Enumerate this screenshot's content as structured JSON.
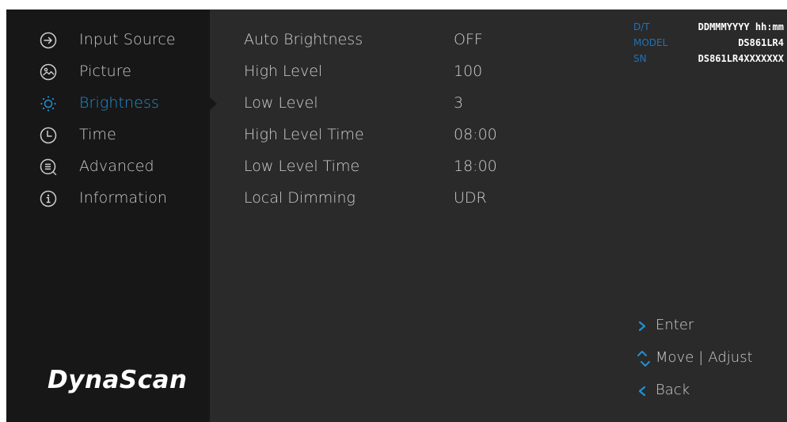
{
  "sidebar": {
    "items": [
      {
        "label": "Input Source",
        "icon": "input-source-icon"
      },
      {
        "label": "Picture",
        "icon": "picture-icon"
      },
      {
        "label": "Brightness",
        "icon": "brightness-icon"
      },
      {
        "label": "Time",
        "icon": "clock-icon"
      },
      {
        "label": "Advanced",
        "icon": "advanced-icon"
      },
      {
        "label": "Information",
        "icon": "info-icon"
      }
    ],
    "active_index": 2
  },
  "brand": {
    "logo_text": "DynaScan"
  },
  "settings": {
    "rows": [
      {
        "name": "Auto Brightness",
        "value": "OFF"
      },
      {
        "name": "High Level",
        "value": "100"
      },
      {
        "name": "Low Level",
        "value": "3"
      },
      {
        "name": "High Level Time",
        "value": "08:00"
      },
      {
        "name": "Low Level Time",
        "value": "18:00"
      },
      {
        "name": "Local Dimming",
        "value": "UDR"
      }
    ]
  },
  "device_info": {
    "dt_label": "D/T",
    "dt_value": "DDMMMYYYY hh:mm",
    "model_label": "MODEL",
    "model_value": "DS861LR4",
    "sn_label": "SN",
    "sn_value": "DS861LR4XXXXXXX"
  },
  "hints": {
    "enter": "Enter",
    "move": "Move",
    "divider": "|",
    "adjust": "Adjust",
    "back": "Back"
  },
  "colors": {
    "accent": "#1f91d6",
    "sidebar_bg": "#171717",
    "panel_bg": "#2a2a2a",
    "text": "#cfcfcf"
  }
}
